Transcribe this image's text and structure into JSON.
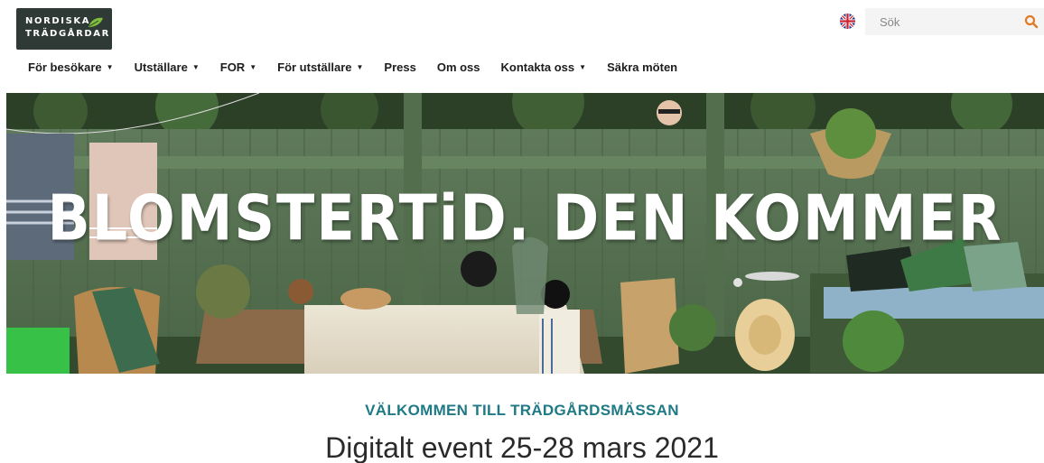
{
  "brand": {
    "line1": "NORDISKA",
    "line2": "TRÄDGÅRDAR"
  },
  "header": {
    "language_icon": "uk-flag-icon",
    "search": {
      "placeholder": "Sök",
      "icon": "search-icon"
    }
  },
  "colors": {
    "accent": "#e07b24",
    "heading_teal": "#1f7a86",
    "logo_bg": "#2f3a36"
  },
  "nav": {
    "items": [
      {
        "label": "För besökare",
        "dropdown": true
      },
      {
        "label": "Utställare",
        "dropdown": true
      },
      {
        "label": "FOR",
        "dropdown": true
      },
      {
        "label": "För utställare",
        "dropdown": true
      },
      {
        "label": "Press",
        "dropdown": false
      },
      {
        "label": "Om oss",
        "dropdown": false
      },
      {
        "label": "Kontakta oss",
        "dropdown": true
      },
      {
        "label": "Säkra möten",
        "dropdown": false
      }
    ]
  },
  "hero": {
    "headline": "BLOMSTERTiD. DEN KOMMER"
  },
  "intro": {
    "welcome": "VÄLKOMMEN TILL TRÄDGÅRDSMÄSSAN",
    "event": "Digitalt event 25-28 mars 2021"
  }
}
